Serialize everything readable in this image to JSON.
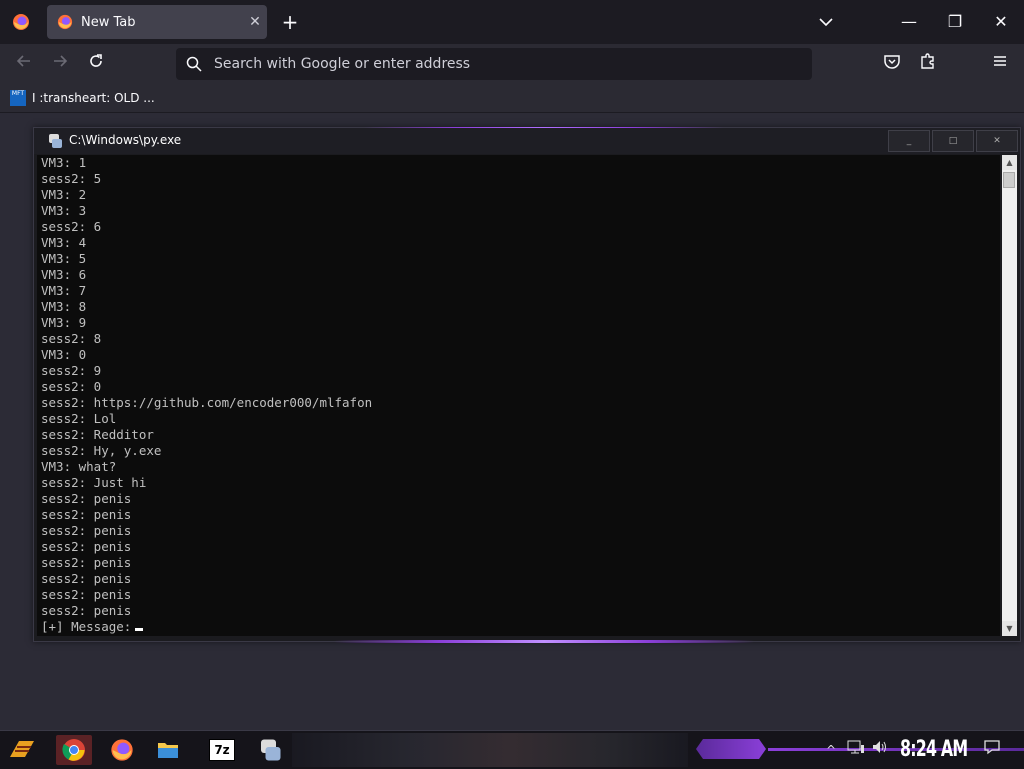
{
  "browser": {
    "tab_title": "New Tab",
    "tab_close": "✕",
    "new_tab": "+",
    "window_controls": {
      "minimize": "—",
      "maximize": "❐",
      "close": "✕"
    },
    "search_placeholder": "Search with Google or enter address",
    "bookmark_label": "I :transheart: OLD ...",
    "bookmark_icon_text": "MFT"
  },
  "console": {
    "title": "C:\\Windows\\py.exe",
    "buttons": {
      "minimize": "_",
      "maximize": "□",
      "close": "✕"
    },
    "lines": [
      "VM3: 1",
      "sess2: 5",
      "VM3: 2",
      "VM3: 3",
      "sess2: 6",
      "VM3: 4",
      "VM3: 5",
      "VM3: 6",
      "VM3: 7",
      "VM3: 8",
      "VM3: 9",
      "sess2: 8",
      "VM3: 0",
      "sess2: 9",
      "sess2: 0",
      "sess2: https://github.com/encoder000/mlfafon",
      "sess2: Lol",
      "sess2: Redditor",
      "sess2: Hy, y.exe",
      "VM3: what?",
      "sess2: Just hi",
      "sess2: penis",
      "sess2: penis",
      "sess2: penis",
      "sess2: penis",
      "sess2: penis",
      "sess2: penis",
      "sess2: penis",
      "sess2: penis"
    ],
    "prompt": "[+] Message:"
  },
  "taskbar": {
    "clock": "8:24 AM",
    "tray_chevron": "^",
    "seven_zip_label": "7z"
  },
  "colors": {
    "accent_purple": "#8b3fd9",
    "console_bg": "#0c0c0c",
    "console_text": "#c0c0c0"
  }
}
